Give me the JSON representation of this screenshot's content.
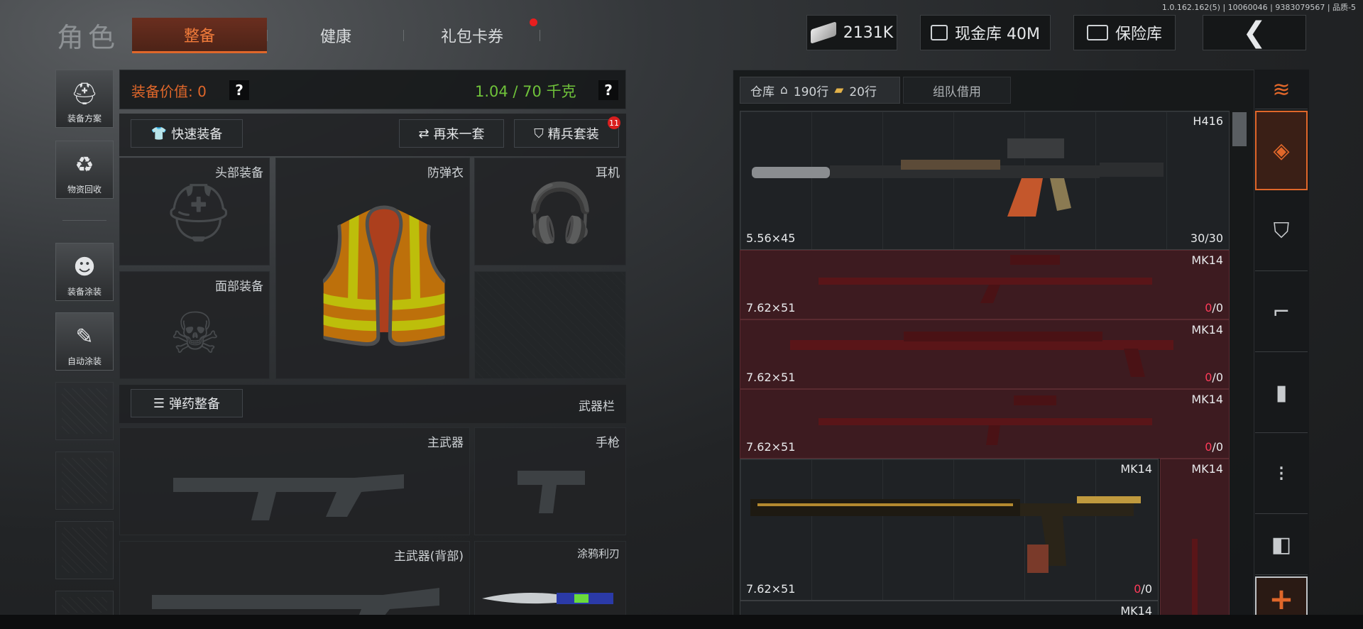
{
  "version": "1.0.162.162(5) | 10060046 | 9383079567 | 品质-5",
  "header": {
    "title": "角色",
    "tabs": [
      "整备",
      "健康",
      "礼包卡券"
    ]
  },
  "topbar": {
    "money": "2131K",
    "cash_vault": "现金库 40M",
    "safe": "保险库"
  },
  "side": {
    "loadout": "装备方案",
    "recycle": "物资回收",
    "skin": "装备涂装",
    "auto_skin": "自动涂装"
  },
  "equip": {
    "value_label": "装备价值: 0",
    "weight": "1.04 / 70 千克",
    "quick_equip": "快速装备",
    "again": "再来一套",
    "elite": "精兵套装",
    "elite_badge": "11",
    "slots": {
      "head": "头部装备",
      "armor": "防弹衣",
      "earphone": "耳机",
      "face": "面部装备"
    },
    "ammo": "弹药整备",
    "weapon_bar": "武器栏",
    "weapons": {
      "primary": "主武器",
      "pistol": "手枪",
      "primary_back": "主武器(背部)",
      "melee": "涂鸦利刃"
    }
  },
  "storage": {
    "tab": "仓库",
    "rows1": "190行",
    "rows2": "20行",
    "team": "组队借用",
    "items": [
      {
        "name": "H416",
        "cal": "5.56×45",
        "count": "30/30",
        "red": false
      },
      {
        "name": "MK14",
        "cal": "7.62×51",
        "count_a": "0",
        "count_b": "/0",
        "red": true
      },
      {
        "name": "MK14",
        "cal": "7.62×51",
        "count_a": "0",
        "count_b": "/0",
        "red": true
      },
      {
        "name": "MK14",
        "cal": "7.62×51",
        "count_a": "0",
        "count_b": "/0",
        "red": true
      },
      {
        "name": "MK14",
        "name2": "MK14",
        "cal": "7.62×51",
        "count_a": "0",
        "count_b": "/0",
        "red": false
      },
      {
        "name": "MK14",
        "red": false
      }
    ]
  },
  "colors": {
    "accent": "#e0672a",
    "green": "#6fc23a",
    "red": "#ff3b5a"
  }
}
